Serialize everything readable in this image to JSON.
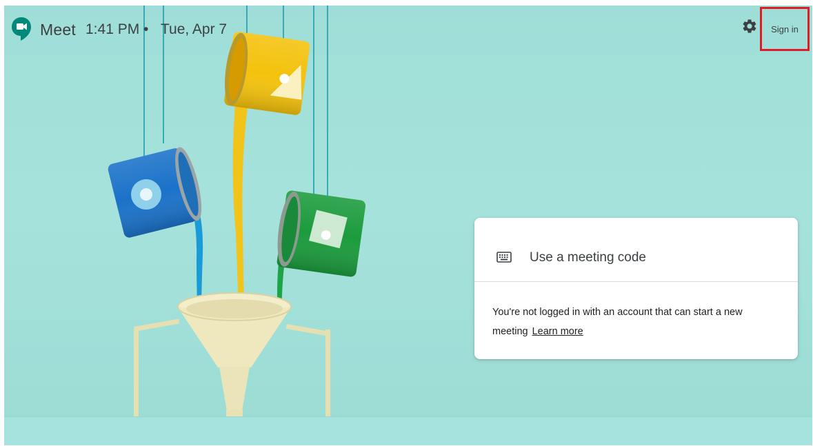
{
  "header": {
    "app_name": "Meet",
    "time": "1:41 PM",
    "separator": "•",
    "date": "Tue, Apr 7",
    "sign_in_label": "Sign in",
    "icons": {
      "logo": "google-meet-logo",
      "settings": "gear-icon"
    }
  },
  "card": {
    "meeting_code_label": "Use a meeting code",
    "meeting_code_icon": "keyboard-icon",
    "notice_text": "You're not logged in with an account that can start a new meeting",
    "learn_more_label": "Learn more"
  },
  "colors": {
    "background": "#9fded8",
    "signin_highlight": "#e01b24",
    "paint_blue": "#1976d2",
    "paint_yellow": "#f4c20d",
    "paint_green": "#1e9e3e",
    "funnel": "#efe9c0",
    "meet_logo": "#00897b"
  }
}
